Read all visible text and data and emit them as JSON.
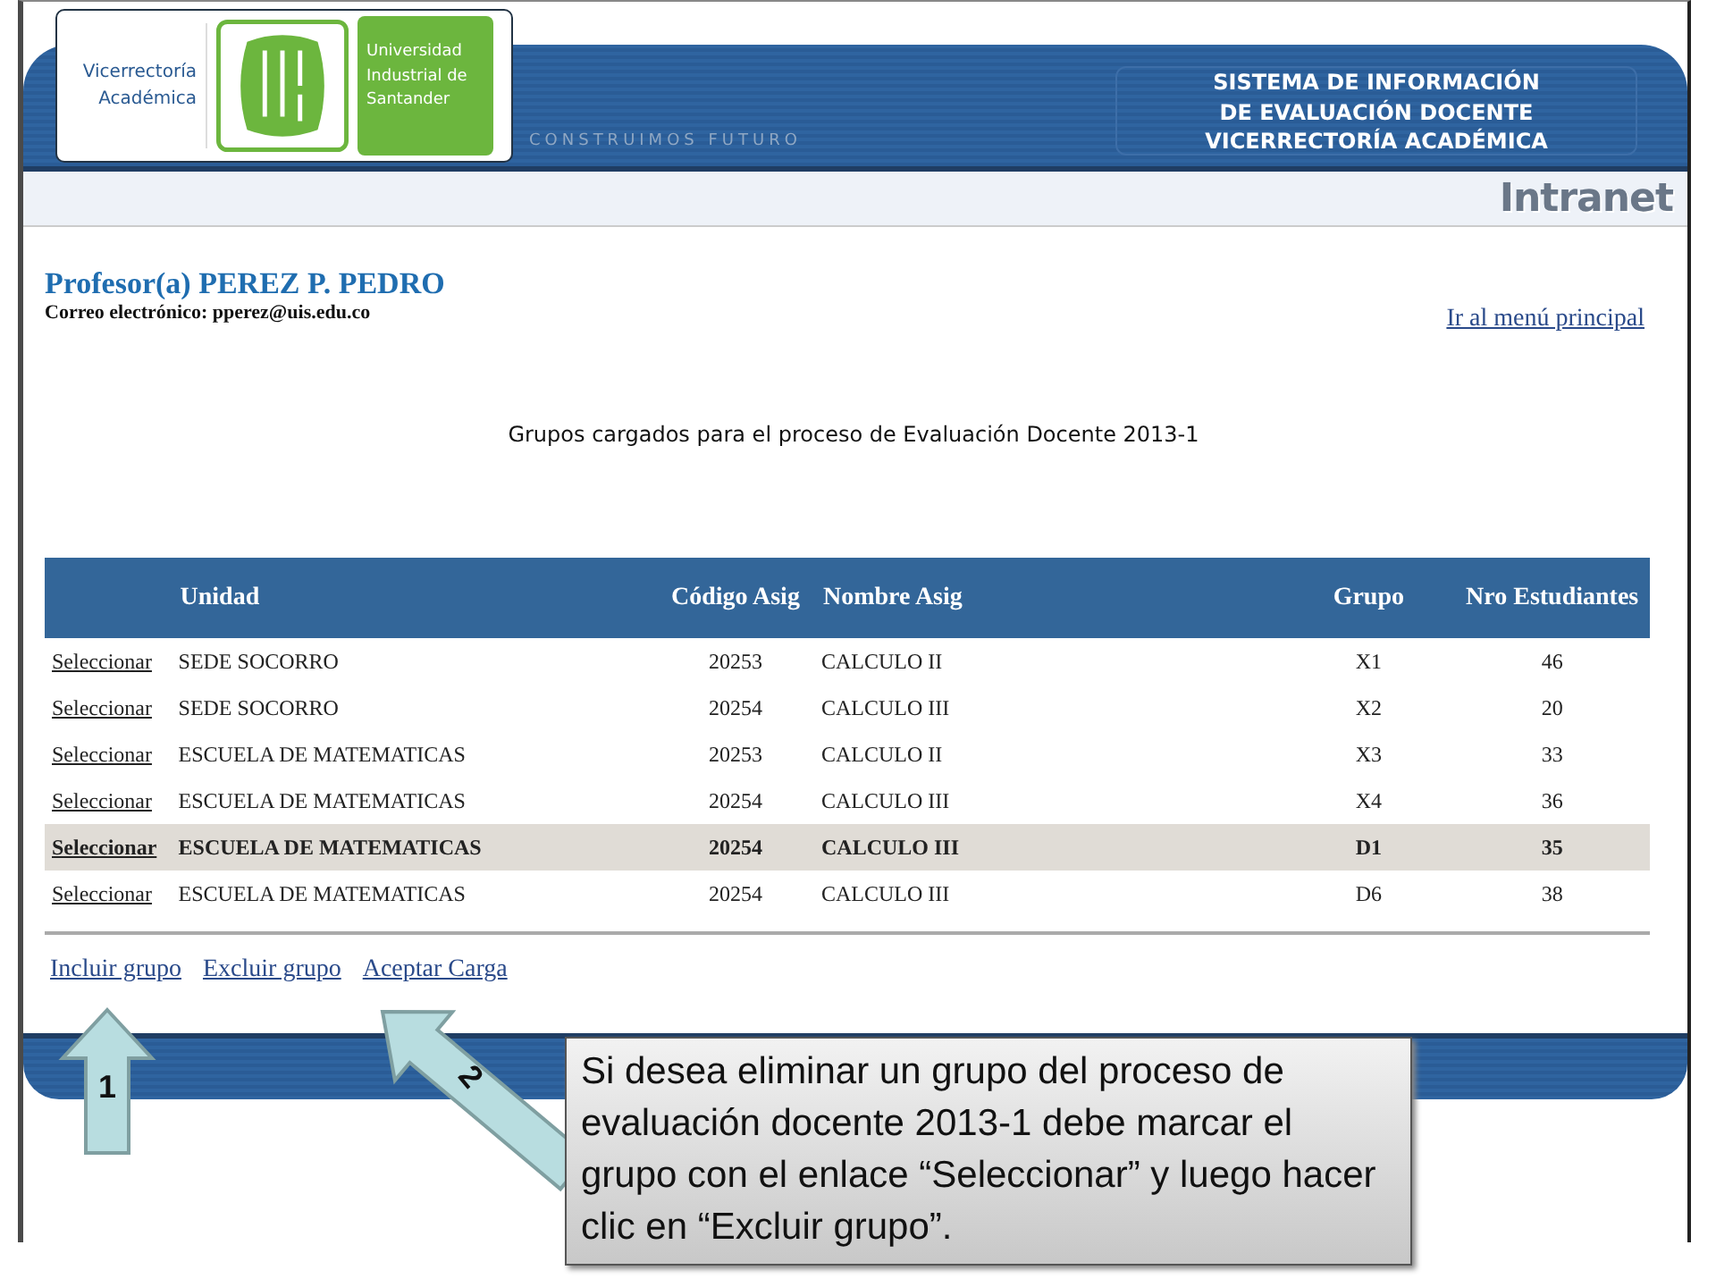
{
  "header": {
    "unit_name": "Vicerrectoría Académica",
    "university_name": "Universidad Industrial de Santander",
    "slogan": "CONSTRUIMOS FUTURO",
    "system_title": [
      "SISTEMA DE INFORMACIÓN",
      "DE EVALUACIÓN DOCENTE",
      "VICERRECTORÍA ACADÉMICA"
    ],
    "intranet": "Intranet"
  },
  "professor": {
    "name": "Profesor(a) PEREZ P. PEDRO",
    "email": "Correo electrónico: pperez@uis.edu.co",
    "main_menu_link": "Ir al menú principal"
  },
  "page_title": "Grupos cargados para el proceso de Evaluación Docente 2013-1",
  "table": {
    "columns": [
      "Unidad",
      "Código Asig",
      "Nombre Asig",
      "Grupo",
      "Nro Estudiantes"
    ],
    "rows": [
      {
        "action": "Seleccionar",
        "unidad": "SEDE SOCORRO",
        "codigo": "20253",
        "nombre": "CALCULO II",
        "grupo": "X1",
        "estudiantes": "46",
        "selected": false
      },
      {
        "action": "Seleccionar",
        "unidad": "SEDE SOCORRO",
        "codigo": "20254",
        "nombre": "CALCULO III",
        "grupo": "X2",
        "estudiantes": "20",
        "selected": false
      },
      {
        "action": "Seleccionar",
        "unidad": "ESCUELA DE MATEMATICAS",
        "codigo": "20253",
        "nombre": "CALCULO II",
        "grupo": "X3",
        "estudiantes": "33",
        "selected": false
      },
      {
        "action": "Seleccionar",
        "unidad": "ESCUELA DE MATEMATICAS",
        "codigo": "20254",
        "nombre": "CALCULO III",
        "grupo": "X4",
        "estudiantes": "36",
        "selected": false
      },
      {
        "action": "Seleccionar",
        "unidad": "ESCUELA DE MATEMATICAS",
        "codigo": "20254",
        "nombre": "CALCULO III",
        "grupo": "D1",
        "estudiantes": "35",
        "selected": true
      },
      {
        "action": "Seleccionar",
        "unidad": "ESCUELA DE MATEMATICAS",
        "codigo": "20254",
        "nombre": "CALCULO III",
        "grupo": "D6",
        "estudiantes": "38",
        "selected": false
      }
    ]
  },
  "actions": [
    "Incluir grupo",
    "Excluir grupo",
    "Aceptar Carga"
  ],
  "annotations": {
    "steps": [
      "1",
      "2"
    ],
    "callout": "Si desea eliminar un grupo del proceso de evaluación docente 2013-1 debe marcar el grupo con el enlace “Seleccionar” y luego hacer clic en “Excluir grupo”."
  }
}
